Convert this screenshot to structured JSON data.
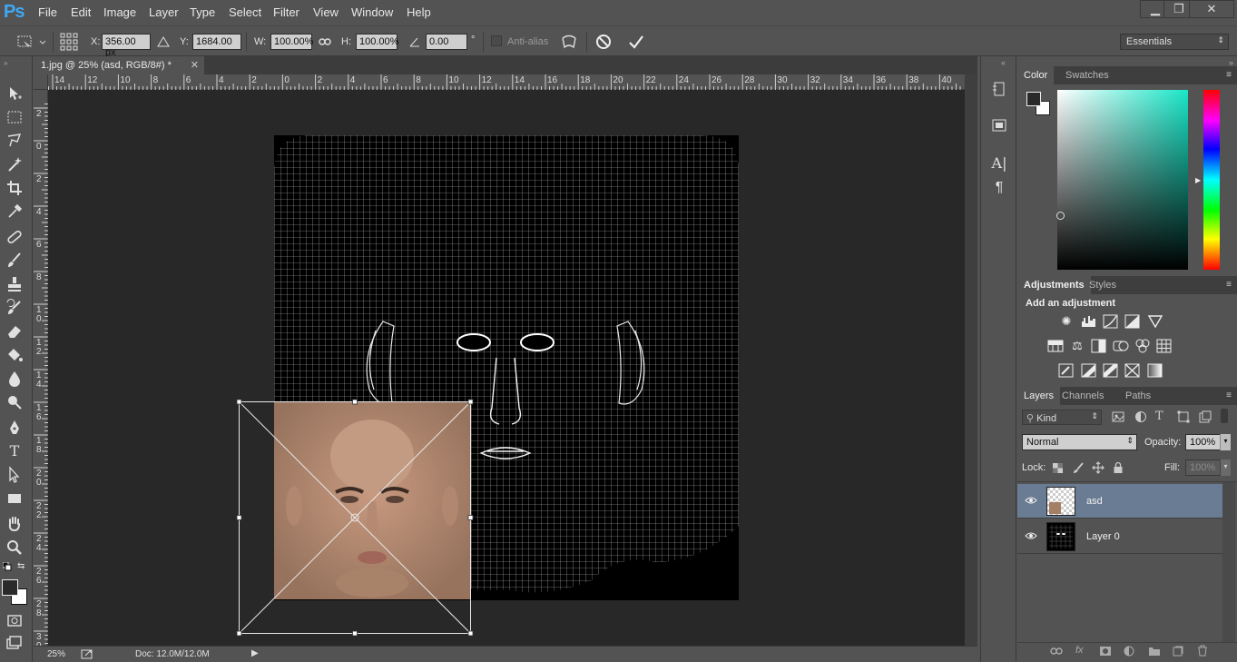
{
  "app": {
    "logo": "Ps"
  },
  "menu": [
    "File",
    "Edit",
    "Image",
    "Layer",
    "Type",
    "Select",
    "Filter",
    "View",
    "Window",
    "Help"
  ],
  "window_controls": {
    "minimize": "▁",
    "restore": "❐",
    "close": "✕"
  },
  "options": {
    "x_label": "X:",
    "x_value": "356.00 px",
    "y_label": "Y:",
    "y_value": "1684.00 px",
    "w_label": "W:",
    "w_value": "100.00%",
    "h_label": "H:",
    "h_value": "100.00%",
    "angle_value": "0.00",
    "angle_unit": "°",
    "antialias_label": "Anti-alias",
    "workspace": "Essentials"
  },
  "document": {
    "tab_title": "1.jpg @ 25% (asd, RGB/8#) *",
    "zoom": "25%",
    "doc_info": "Doc: 12.0M/12.0M"
  },
  "rulers": {
    "horizontal": [
      "14",
      "12",
      "10",
      "8",
      "6",
      "4",
      "2",
      "0",
      "2",
      "4",
      "6",
      "8",
      "10",
      "12",
      "14",
      "16",
      "18",
      "20",
      "22",
      "24",
      "26",
      "28",
      "30",
      "32",
      "34",
      "36",
      "38",
      "40"
    ],
    "vertical": [
      "2",
      "0",
      "2",
      "4",
      "6",
      "8",
      "10",
      "12",
      "14",
      "16",
      "18",
      "20",
      "22",
      "24",
      "26",
      "28",
      "30"
    ]
  },
  "color_panel": {
    "tabs": [
      "Color",
      "Swatches"
    ]
  },
  "adjustments_panel": {
    "tabs": [
      "Adjustments",
      "Styles"
    ],
    "heading": "Add an adjustment",
    "icons": [
      [
        "brightness-icon",
        "levels-icon",
        "curves-icon",
        "exposure-icon",
        "vibrance-icon"
      ],
      [
        "hue-saturation-icon",
        "color-balance-icon",
        "black-white-icon",
        "photo-filter-icon",
        "channel-mixer-icon",
        "color-lookup-icon"
      ],
      [
        "invert-icon",
        "posterize-icon",
        "threshold-icon",
        "selective-color-icon",
        "gradient-map-icon"
      ]
    ]
  },
  "layers_panel": {
    "tabs": [
      "Layers",
      "Channels",
      "Paths"
    ],
    "filter_kind": "Kind",
    "blend_mode": "Normal",
    "opacity_label": "Opacity:",
    "opacity_value": "100%",
    "lock_label": "Lock:",
    "fill_label": "Fill:",
    "fill_value": "100%",
    "layers": [
      {
        "name": "asd",
        "selected": true
      },
      {
        "name": "Layer 0",
        "selected": false
      }
    ]
  },
  "colors": {
    "accent": "#3fa9f5",
    "selected_layer": "#6a7c93",
    "canvas_bg": "#282828"
  }
}
